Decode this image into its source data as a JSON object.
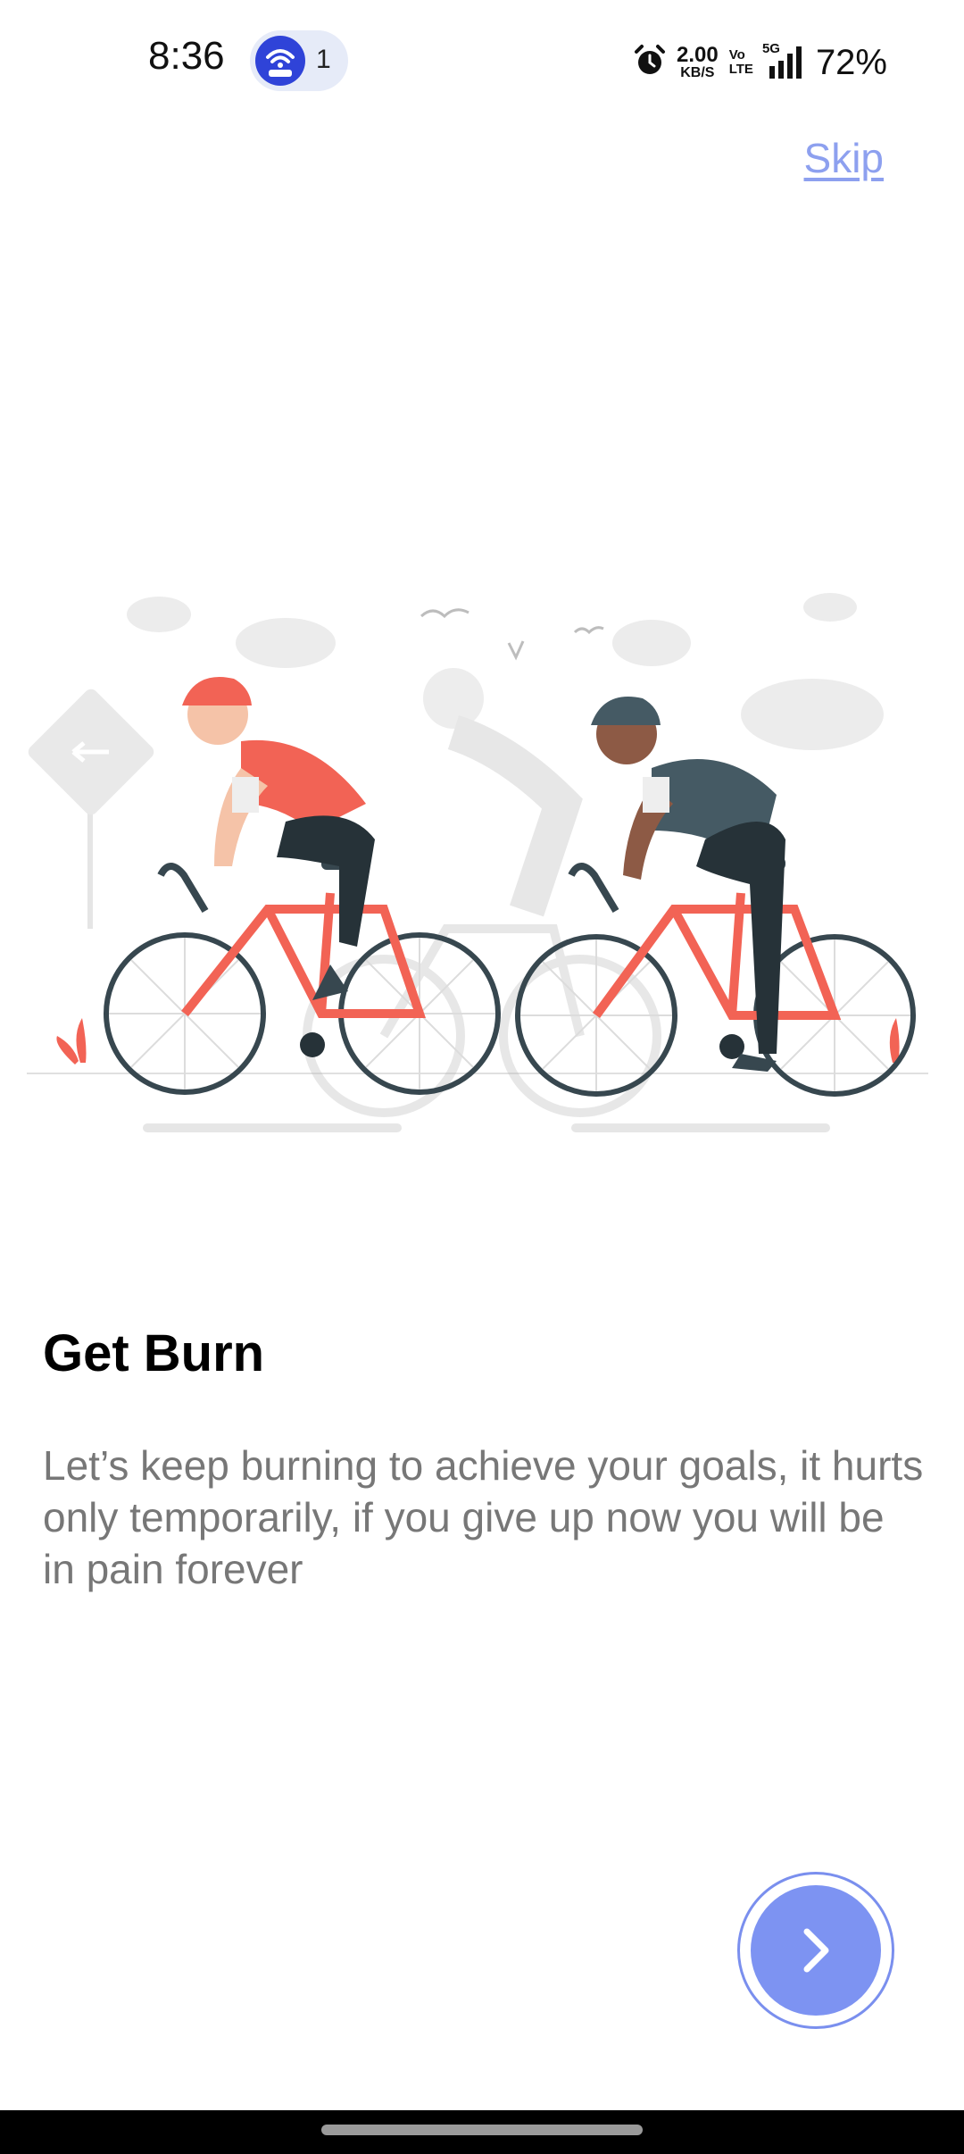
{
  "status_bar": {
    "time": "8:36",
    "hotspot_count": "1",
    "net_speed_value": "2.00",
    "net_speed_unit": "KB/S",
    "volte_line1": "Vo",
    "volte_line2": "LTE",
    "network": "5G",
    "battery": "72%",
    "icons": [
      "hotspot-icon",
      "alarm-icon",
      "signal-icon"
    ]
  },
  "onboarding": {
    "skip_label": "Skip",
    "title": "Get Burn",
    "description": "Let’s keep burning to achieve your goals, it hurts only temporarily, if you give up now you will be in pain forever",
    "next_icon": "chevron-right-icon"
  },
  "colors": {
    "accent": "#7d93f2",
    "skip": "#8da0ef",
    "description_text": "#777777",
    "cyclist_red": "#f26355",
    "cyclist_dark": "#37474f"
  }
}
